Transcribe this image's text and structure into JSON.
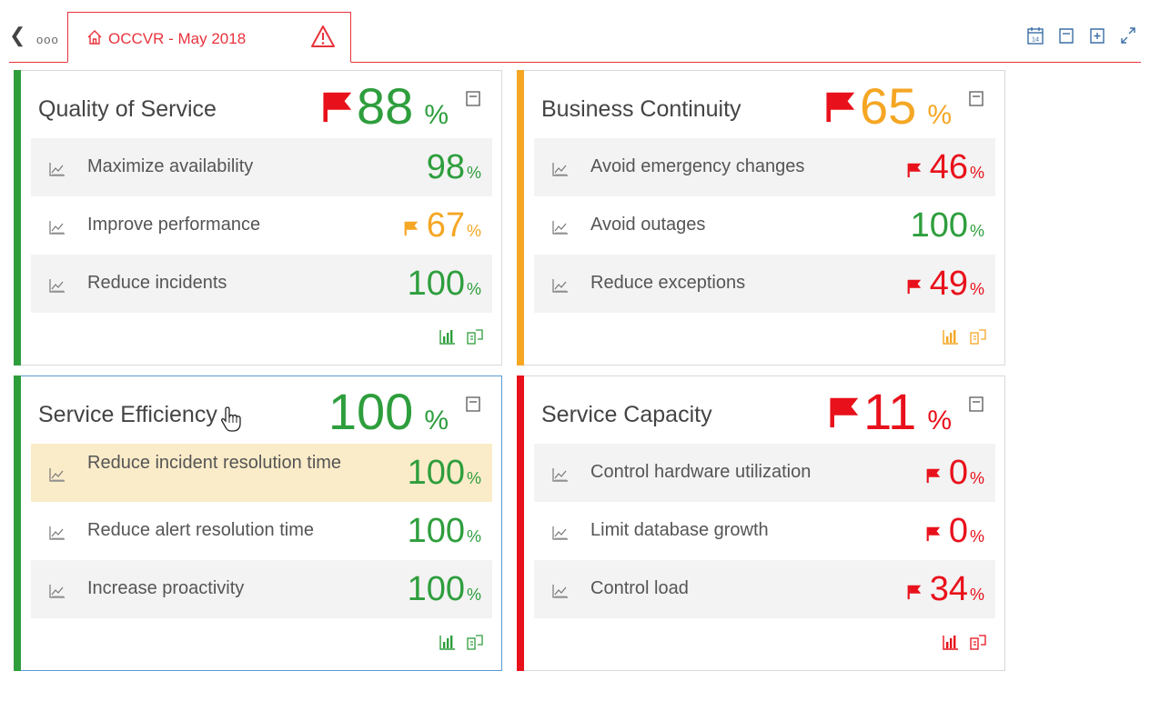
{
  "nav": {
    "back_icon": "chevron-left-icon",
    "more_label": "ooo"
  },
  "tab": {
    "title": "OCCVR - May 2018",
    "home_icon": "home-icon",
    "warning_icon": "warning-icon"
  },
  "toolbar": {
    "icons": [
      "calendar-icon",
      "collapse-icon",
      "add-icon",
      "fullscreen-icon"
    ],
    "calendar_day": "14"
  },
  "colors": {
    "green": "#2e9e3d",
    "orange": "#f5a623",
    "red": "#e8111b",
    "accent_red": "#e8323c"
  },
  "cards": [
    {
      "title": "Quality of Service",
      "score": "88",
      "unit": "%",
      "status": "green",
      "flag": true,
      "items": [
        {
          "label": "Maximize availability",
          "value": "98",
          "unit": "%",
          "status": "green",
          "flag": false
        },
        {
          "label": "Improve performance",
          "value": "67",
          "unit": "%",
          "status": "orange",
          "flag": true
        },
        {
          "label": "Reduce incidents",
          "value": "100",
          "unit": "%",
          "status": "green",
          "flag": false
        }
      ]
    },
    {
      "title": "Business Continuity",
      "score": "65",
      "unit": "%",
      "status": "orange",
      "flag": true,
      "items": [
        {
          "label": "Avoid emergency changes",
          "value": "46",
          "unit": "%",
          "status": "red",
          "flag": true
        },
        {
          "label": "Avoid outages",
          "value": "100",
          "unit": "%",
          "status": "green",
          "flag": false
        },
        {
          "label": "Reduce exceptions",
          "value": "49",
          "unit": "%",
          "status": "red",
          "flag": true
        }
      ]
    },
    {
      "title": "Service Efficiency",
      "score": "100",
      "unit": "%",
      "status": "green",
      "flag": false,
      "items": [
        {
          "label": "Reduce incident resolution time",
          "value": "100",
          "unit": "%",
          "status": "green",
          "flag": false
        },
        {
          "label": "Reduce alert resolution time",
          "value": "100",
          "unit": "%",
          "status": "green",
          "flag": false
        },
        {
          "label": "Increase proactivity",
          "value": "100",
          "unit": "%",
          "status": "green",
          "flag": false
        }
      ]
    },
    {
      "title": "Service Capacity",
      "score": "11",
      "unit": "%",
      "status": "red",
      "flag": true,
      "items": [
        {
          "label": "Control hardware utilization",
          "value": "0",
          "unit": "%",
          "status": "red",
          "flag": true
        },
        {
          "label": "Limit database growth",
          "value": "0",
          "unit": "%",
          "status": "red",
          "flag": true
        },
        {
          "label": "Control load",
          "value": "34",
          "unit": "%",
          "status": "red",
          "flag": true
        }
      ]
    }
  ]
}
